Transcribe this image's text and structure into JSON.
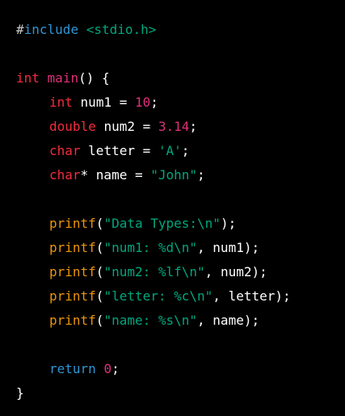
{
  "colors": {
    "background": "#000000",
    "preprocessor": "#2e95d3",
    "header": "#00a67d",
    "keyword_type": "#f22c3d",
    "function_name": "#df3079",
    "number": "#df3079",
    "string": "#00a67d",
    "call": "#e9950c",
    "return_keyword": "#2e95d3",
    "plain": "#ffffff"
  },
  "code": {
    "l1": {
      "hash": "#",
      "directive": "include",
      "sp": " ",
      "header": "<stdio.h>"
    },
    "l3": {
      "type": "int",
      "sp": " ",
      "fname": "main",
      "rest": "() {"
    },
    "l4": {
      "type": "int",
      "sp": " ",
      "var": "num1 = ",
      "num": "10",
      "end": ";"
    },
    "l5": {
      "type": "double",
      "sp": " ",
      "var": "num2 = ",
      "num": "3.14",
      "end": ";"
    },
    "l6": {
      "type": "char",
      "sp": " ",
      "var": "letter = ",
      "str": "'A'",
      "end": ";"
    },
    "l7": {
      "type": "char",
      "rest": "* name = ",
      "str": "\"John\"",
      "end": ";"
    },
    "l9": {
      "fn": "printf",
      "open": "(",
      "str": "\"Data Types:\\n\"",
      "rest": ");"
    },
    "l10": {
      "fn": "printf",
      "open": "(",
      "str": "\"num1: %d\\n\"",
      "rest": ", num1);"
    },
    "l11": {
      "fn": "printf",
      "open": "(",
      "str": "\"num2: %lf\\n\"",
      "rest": ", num2);"
    },
    "l12": {
      "fn": "printf",
      "open": "(",
      "str": "\"letter: %c\\n\"",
      "rest": ", letter);"
    },
    "l13": {
      "fn": "printf",
      "open": "(",
      "str": "\"name: %s\\n\"",
      "rest": ", name);"
    },
    "l15": {
      "kw": "return",
      "sp": " ",
      "num": "0",
      "end": ";"
    },
    "l16": {
      "brace": "}"
    }
  }
}
